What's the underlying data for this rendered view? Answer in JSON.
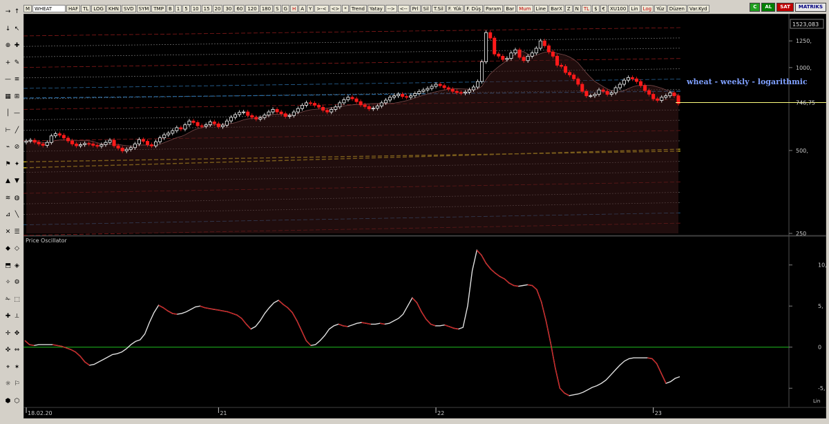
{
  "toolbar": {
    "symbol": "WHEAT",
    "items": [
      "M",
      "B",
      "1",
      "5",
      "10",
      "15",
      "20",
      "30",
      "60",
      "120",
      "180",
      "S",
      "G",
      "H",
      "A",
      "Y",
      ">-<",
      "<>",
      "*",
      "Trend",
      "Yatay",
      "-->",
      "<--",
      "Prl",
      "Sil",
      "T.Sil",
      "F. Yük",
      "F. Düş",
      "Param",
      "Bar",
      "Mum",
      "Line",
      "BarX",
      "Z",
      "N",
      "TL",
      "$",
      "€",
      "XU100",
      "Lin",
      "Log",
      "Yüz",
      "Düzen",
      "Var.Kyd"
    ],
    "extra": [
      "HAF",
      "TL",
      "LOG",
      "KHN",
      "SVD",
      "SYM",
      "TMP"
    ],
    "right": {
      "c": "C",
      "al": "AL",
      "sat": "SAT",
      "brand": "MATRIKS"
    }
  },
  "colors": {
    "up": "#ffffff",
    "down": "#ff1a1a",
    "background": "#000000",
    "oscillator_line": "#cc2020",
    "zero_line": "#20c020",
    "last_price_line": "#ffff80",
    "annotation": "#7fa0ff"
  },
  "annotation": "wheat - weekly - logarithmic",
  "price_panel": {
    "last_price_label": "746,75",
    "top_price_label": "1523,083"
  },
  "oscillator_panel": {
    "title": "Price Oscillator",
    "scale_note": "Lin"
  },
  "time_axis": {
    "labels": [
      {
        "text": "18.02.20",
        "week": 0
      },
      {
        "text": "21",
        "week": 46
      },
      {
        "text": "22",
        "week": 98
      },
      {
        "text": "23",
        "week": 150
      }
    ]
  },
  "chart_data": [
    {
      "type": "line",
      "title": "",
      "series": [
        {
          "name": "WHEAT",
          "style": "candlestick",
          "close": [
            541,
            545,
            536,
            528,
            522,
            535,
            565,
            575,
            568,
            555,
            542,
            528,
            520,
            525,
            530,
            528,
            522,
            518,
            525,
            535,
            545,
            520,
            510,
            498,
            505,
            512,
            528,
            548,
            540,
            525,
            520,
            538,
            556,
            570,
            578,
            590,
            605,
            598,
            620,
            640,
            632,
            615,
            612,
            620,
            635,
            625,
            610,
            618,
            640,
            660,
            675,
            688,
            690,
            670,
            660,
            650,
            658,
            672,
            690,
            705,
            690,
            680,
            665,
            670,
            690,
            710,
            730,
            745,
            742,
            730,
            718,
            700,
            690,
            705,
            720,
            745,
            765,
            780,
            770,
            752,
            732,
            722,
            708,
            712,
            725,
            745,
            762,
            780,
            790,
            800,
            785,
            780,
            790,
            805,
            820,
            830,
            840,
            855,
            870,
            860,
            845,
            835,
            820,
            812,
            808,
            815,
            830,
            850,
            890,
            1050,
            1340,
            1280,
            1120,
            1100,
            1070,
            1080,
            1130,
            1160,
            1090,
            1060,
            1100,
            1130,
            1175,
            1250,
            1200,
            1140,
            1100,
            1020,
            1010,
            960,
            940,
            910,
            870,
            820,
            790,
            790,
            800,
            830,
            820,
            800,
            810,
            845,
            870,
            900,
            920,
            910,
            890,
            860,
            825,
            800,
            770,
            760,
            780,
            790,
            810,
            790,
            740
          ],
          "ohlc_mode": "derived"
        }
      ],
      "yscale": "log",
      "ylim": [
        250,
        1523.083
      ],
      "yticks": [
        250,
        500,
        1000,
        1250
      ],
      "ytick_labels": [
        "250",
        "500,",
        "1000,",
        "1250,"
      ],
      "x_unit": "week",
      "xlim": [
        0,
        155
      ]
    },
    {
      "type": "line",
      "title": "Price Oscillator",
      "series": [
        {
          "name": "Price Oscillator",
          "values": [
            0.8,
            0.3,
            0.2,
            0.3,
            0.3,
            0.3,
            0.3,
            0.2,
            0.1,
            -0.1,
            -0.3,
            -0.6,
            -1.1,
            -1.8,
            -2.2,
            -2.1,
            -1.8,
            -1.5,
            -1.2,
            -0.9,
            -0.8,
            -0.6,
            -0.2,
            0.3,
            0.7,
            0.9,
            1.6,
            3.0,
            4.2,
            5.1,
            4.8,
            4.4,
            4.1,
            4.0,
            4.1,
            4.3,
            4.6,
            4.9,
            5.0,
            4.8,
            4.7,
            4.6,
            4.5,
            4.4,
            4.3,
            4.1,
            3.9,
            3.5,
            2.8,
            2.2,
            2.5,
            3.2,
            4.1,
            4.8,
            5.4,
            5.7,
            5.2,
            4.8,
            4.2,
            3.2,
            2.0,
            0.8,
            0.2,
            0.3,
            0.8,
            1.4,
            2.2,
            2.6,
            2.8,
            2.6,
            2.5,
            2.7,
            2.9,
            3.0,
            2.9,
            2.8,
            2.8,
            2.9,
            2.8,
            2.9,
            3.2,
            3.5,
            4.0,
            5.0,
            6.0,
            5.4,
            4.3,
            3.4,
            2.8,
            2.6,
            2.6,
            2.7,
            2.5,
            2.3,
            2.2,
            2.4,
            5.0,
            9.3,
            11.8,
            11.2,
            10.2,
            9.5,
            9.0,
            8.6,
            8.3,
            7.8,
            7.5,
            7.4,
            7.5,
            7.6,
            7.5,
            7.0,
            5.5,
            3.2,
            0.5,
            -2.5,
            -5.0,
            -5.6,
            -5.9,
            -5.8,
            -5.7,
            -5.5,
            -5.2,
            -4.9,
            -4.7,
            -4.4,
            -4.0,
            -3.4,
            -2.8,
            -2.2,
            -1.7,
            -1.4,
            -1.3,
            -1.3,
            -1.3,
            -1.3,
            -1.4,
            -2.0,
            -3.2,
            -4.4,
            -4.2,
            -3.8,
            -3.6
          ]
        }
      ],
      "zero_line": 0,
      "ylim": [
        -7,
        13
      ],
      "yticks": [
        -5,
        0,
        5,
        10
      ],
      "ytick_labels": [
        "-5,",
        "0",
        "5,",
        "10,"
      ],
      "x_unit": "week",
      "xlim": [
        0,
        155
      ]
    }
  ]
}
